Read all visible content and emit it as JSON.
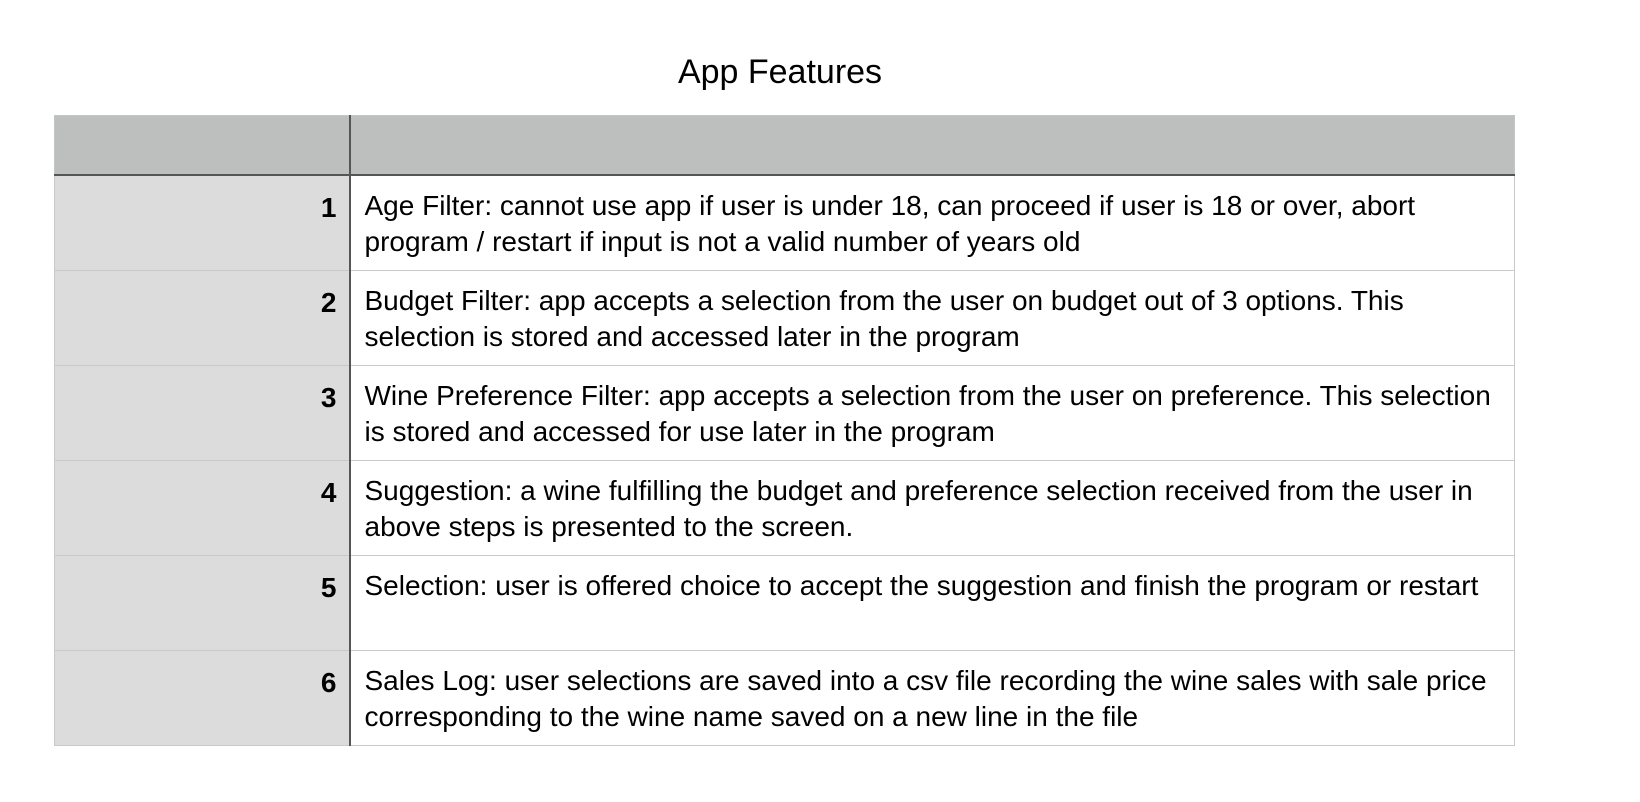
{
  "title": "App Features",
  "table": {
    "header": [
      "",
      ""
    ],
    "rows": [
      {
        "num": "1",
        "text": "Age Filter: cannot use app if user is under 18, can proceed if user is 18 or over, abort program / restart if input is not a valid number of years old"
      },
      {
        "num": "2",
        "text": "Budget Filter: app accepts a selection from the user on budget out of 3 options. This selection is stored and accessed later in the program"
      },
      {
        "num": "3",
        "text": "Wine Preference Filter: app accepts a selection from the user on preference. This selection is stored and accessed for use later in the program"
      },
      {
        "num": "4",
        "text": "Suggestion: a wine fulfilling the budget and preference selection received from the user in above steps is presented to the screen."
      },
      {
        "num": "5",
        "text": "Selection: user is offered choice to accept the suggestion and finish the program or restart"
      },
      {
        "num": "6",
        "text": "Sales Log: user selections are saved into a csv file recording the wine sales with sale price corresponding to the wine name saved on a new line in the file"
      }
    ]
  },
  "colors": {
    "header_bg": "#bdbfbe",
    "number_column_bg": "#dcdcdc",
    "grid_line": "#c9c9c9",
    "header_divider": "#555555"
  }
}
